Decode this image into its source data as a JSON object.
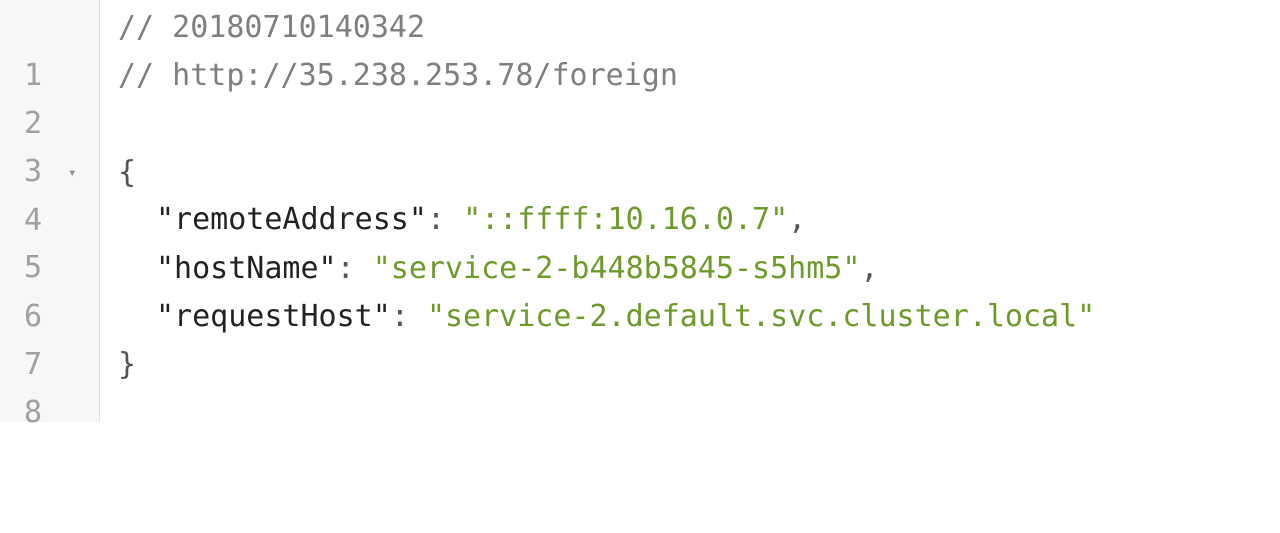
{
  "editor": {
    "line_numbers": [
      "1",
      "2",
      "3",
      "4",
      "5",
      "6",
      "7",
      "8"
    ],
    "fold_marker": "▾",
    "comment_timestamp": "// 20180710140342",
    "comment_url": "// http://35.238.253.78/foreign",
    "brace_open": "{",
    "brace_close": "}",
    "fields": [
      {
        "key": "\"remoteAddress\"",
        "sep": ": ",
        "value": "\"::ffff:10.16.0.7\"",
        "trail": ","
      },
      {
        "key": "\"hostName\"",
        "sep": ": ",
        "value": "\"service-2-b448b5845-s5hm5\"",
        "trail": ","
      },
      {
        "key": "\"requestHost\"",
        "sep": ": ",
        "value": "\"service-2.default.svc.cluster.local\"",
        "trail": ""
      }
    ]
  },
  "colors": {
    "comment": "#7f7f7f",
    "string": "#6e9a2c",
    "key": "#222222",
    "line_number": "#a0a0a0"
  }
}
